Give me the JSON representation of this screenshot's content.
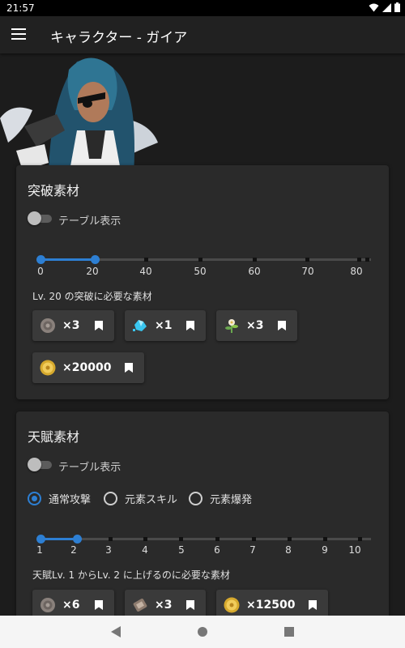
{
  "status_bar": {
    "time": "21:57"
  },
  "app_bar": {
    "title": "キャラクター - ガイア"
  },
  "ascension": {
    "title": "突破素材",
    "toggle_label": "テーブル表示",
    "scale": [
      "0",
      "20",
      "40",
      "50",
      "60",
      "70",
      "80"
    ],
    "selected_fraction": 0.167,
    "caption": "Lv. 20 の突破に必要な素材",
    "materials": [
      {
        "icon": "gray-shell-material-icon",
        "count": "×3"
      },
      {
        "icon": "blue-crystal-material-icon",
        "count": "×1"
      },
      {
        "icon": "flower-material-icon",
        "count": "×3"
      },
      {
        "icon": "mora-coin-icon",
        "count": "×20000"
      }
    ]
  },
  "talent": {
    "title": "天賦素材",
    "toggle_label": "テーブル表示",
    "radios": [
      {
        "label": "通常攻撃",
        "checked": true
      },
      {
        "label": "元素スキル",
        "checked": false
      },
      {
        "label": "元素爆発",
        "checked": false
      }
    ],
    "scale": [
      "1",
      "2",
      "3",
      "4",
      "5",
      "6",
      "7",
      "8",
      "9",
      "10"
    ],
    "selected_fraction": 0.111,
    "caption": "天賦Lv. 1 からLv. 2 に上げるのに必要な素材",
    "materials": [
      {
        "icon": "gray-shell-material-icon",
        "count": "×6"
      },
      {
        "icon": "scroll-material-icon",
        "count": "×3"
      },
      {
        "icon": "mora-coin-icon",
        "count": "×12500"
      }
    ]
  },
  "colors": {
    "accent": "#2d7fd3",
    "card": "#2a2a2a",
    "background": "#1c1c1c"
  }
}
